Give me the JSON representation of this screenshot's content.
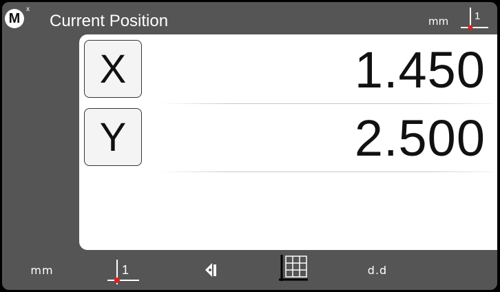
{
  "header": {
    "logo_text": "M",
    "logo_superscript": "x",
    "title": "Current Position",
    "unit": "mm",
    "datum_number": "1"
  },
  "axes": [
    {
      "label": "X",
      "value": "1.450"
    },
    {
      "label": "Y",
      "value": "2.500"
    }
  ],
  "toolbar": {
    "unit_label": "mm",
    "datum_number": "1",
    "resolution_label": "d.d"
  },
  "colors": {
    "background": "#555555",
    "panel": "#ffffff",
    "datum_dot": "#e02020"
  }
}
